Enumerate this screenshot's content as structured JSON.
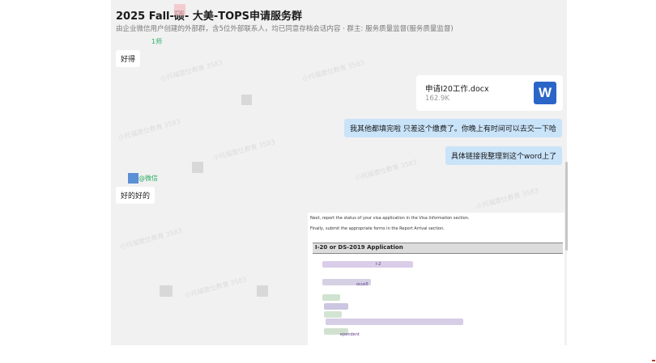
{
  "header": {
    "title": "2025 Fall-硕-  大美-TOPS申请服务群",
    "subtitle": "由企业微信用户创建的外部群，含5位外部联系人，均已同意存档会话内容 · 群主: 服务质量监督(服务质量监督)"
  },
  "messages": {
    "msg1": "好得",
    "msg2": "我其他都填完啦 只差这个缴费了。你晚上有时间可以去交一下哈",
    "msg3": "具体链接我整理到这个word上了",
    "msg4": "好的好的",
    "sender_top": "1师",
    "sender_mid": "@微信"
  },
  "file": {
    "name": "申请I20工作.docx",
    "size": "162.9K",
    "icon_letter": "W"
  },
  "doc": {
    "line1": "Next, report the status of your visa application in the Visa Information section.",
    "line2": "Finally, submit the appropriate forms in the Report Arrival section.",
    "section_title": "I-20 or DS-2019 Application",
    "item_fragment1": "I-2",
    "item_fragment2": "ocus5",
    "item_fragment3": "ependent"
  },
  "watermark": "小托福壹仕教育 3583",
  "colors": {
    "chat_bg": "#f1f1f1",
    "bubble_right": "#c9e3f9",
    "word_blue": "#2b65c8",
    "sender_green": "#2aae67"
  }
}
